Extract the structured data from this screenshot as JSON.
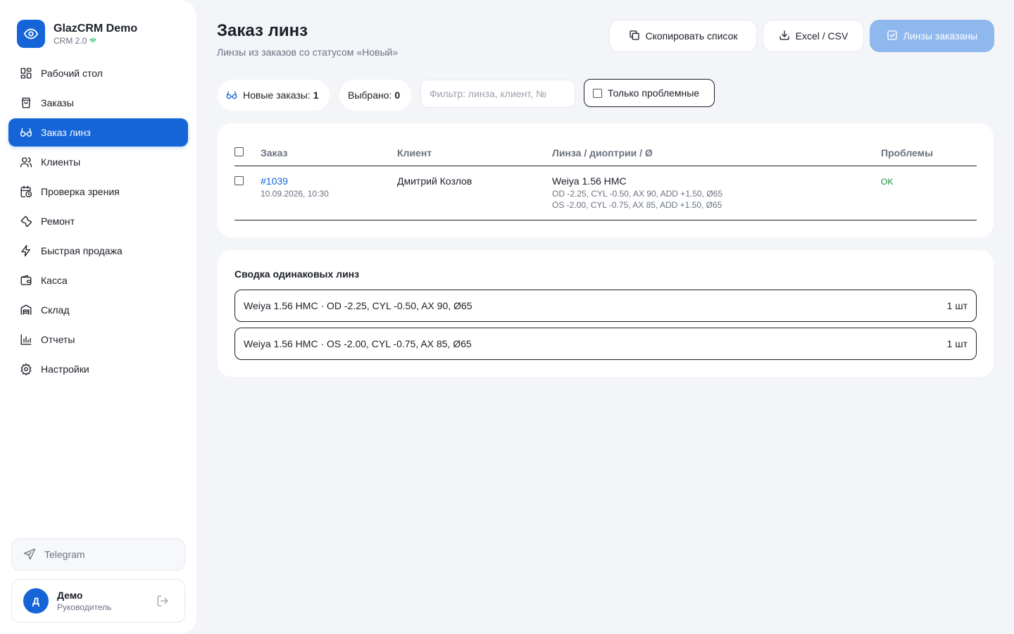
{
  "brand": {
    "name": "GlazCRM Demo",
    "version": "CRM 2.0"
  },
  "nav": [
    {
      "label": "Рабочий стол",
      "icon": "dashboard-icon"
    },
    {
      "label": "Заказы",
      "icon": "shopping-bag-icon"
    },
    {
      "label": "Заказ линз",
      "icon": "glasses-icon",
      "active": true
    },
    {
      "label": "Клиенты",
      "icon": "users-icon"
    },
    {
      "label": "Проверка зрения",
      "icon": "calendar-clock-icon"
    },
    {
      "label": "Ремонт",
      "icon": "wrench-icon"
    },
    {
      "label": "Быстрая продажа",
      "icon": "lightning-icon"
    },
    {
      "label": "Касса",
      "icon": "wallet-icon"
    },
    {
      "label": "Склад",
      "icon": "warehouse-icon"
    },
    {
      "label": "Отчеты",
      "icon": "bar-chart-icon"
    },
    {
      "label": "Настройки",
      "icon": "gear-icon"
    }
  ],
  "telegram": {
    "label": "Telegram"
  },
  "user": {
    "initial": "Д",
    "name": "Демо",
    "role": "Руководитель"
  },
  "header": {
    "title": "Заказ линз",
    "subtitle": "Линзы из заказов со статусом «Новый»",
    "copy_label": "Скопировать список",
    "excel_label": "Excel / CSV",
    "ordered_label": "Линзы заказаны"
  },
  "filters": {
    "new_orders_label": "Новые заказы:",
    "new_orders_count": "1",
    "selected_label": "Выбрано:",
    "selected_count": "0",
    "search_placeholder": "Фильтр: линза, клиент, №",
    "search_value": "",
    "problems_only_label": "Только проблемные"
  },
  "table": {
    "columns": [
      "Заказ",
      "Клиент",
      "Линза / диоптрии / Ø",
      "Проблемы"
    ],
    "rows": [
      {
        "order": "#1039",
        "date": "10.09.2026, 10:30",
        "client": "Дмитрий Козлов",
        "lens": "Weiya 1.56 HMC",
        "od": "OD -2.25, CYL -0.50, AX 90, ADD +1.50, Ø65",
        "os": "OS -2.00, CYL -0.75, AX 85, ADD +1.50, Ø65",
        "problems": "OK"
      }
    ]
  },
  "summary": {
    "title": "Сводка одинаковых линз",
    "items": [
      {
        "lens": "Weiya 1.56 HMC · OD -2.25, CYL -0.50, AX 90, Ø65",
        "qty": "1 шт"
      },
      {
        "lens": "Weiya 1.56 HMC · OS -2.00, CYL -0.75, AX 85, Ø65",
        "qty": "1 шт"
      }
    ]
  },
  "colors": {
    "accent": "#1565d8",
    "ok": "#1b8a3c",
    "disabled_button": "#8fb9ee"
  }
}
